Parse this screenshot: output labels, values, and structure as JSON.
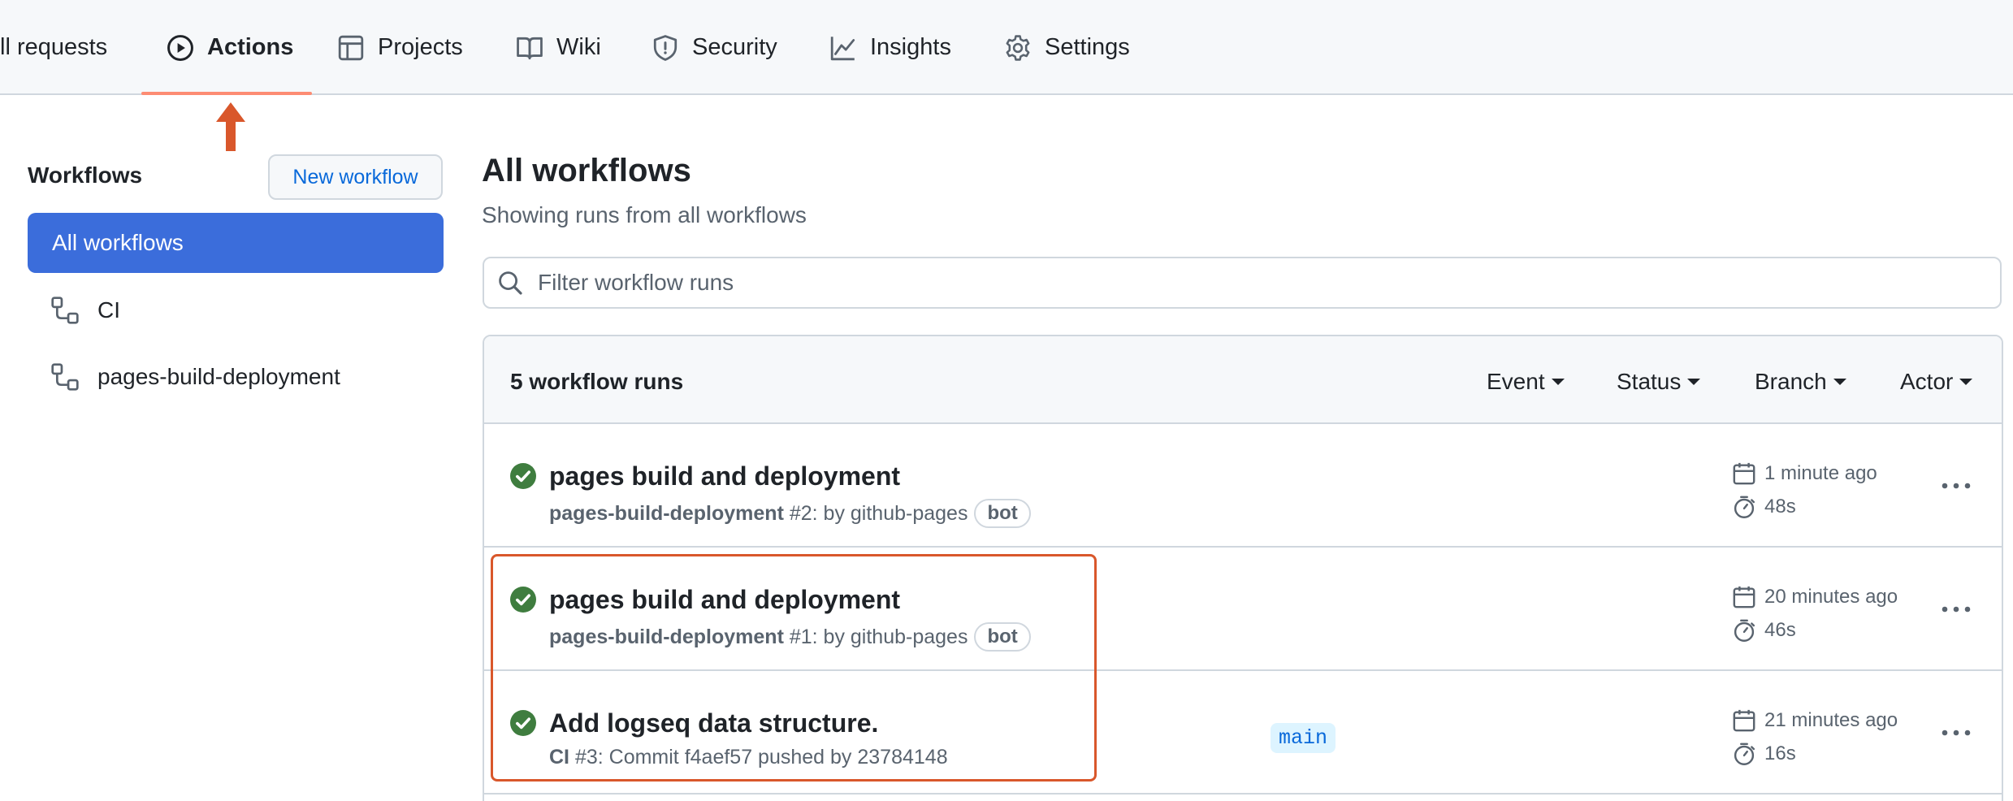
{
  "nav": {
    "tabs": [
      {
        "label": "ll requests",
        "icon": "pull-request-icon"
      },
      {
        "label": "Actions",
        "icon": "play-icon",
        "active": true
      },
      {
        "label": "Projects",
        "icon": "table-icon"
      },
      {
        "label": "Wiki",
        "icon": "book-icon"
      },
      {
        "label": "Security",
        "icon": "shield-icon"
      },
      {
        "label": "Insights",
        "icon": "graph-icon"
      },
      {
        "label": "Settings",
        "icon": "gear-icon"
      }
    ]
  },
  "sidebar": {
    "title": "Workflows",
    "new_workflow_label": "New workflow",
    "items": [
      {
        "label": "All workflows",
        "selected": true
      },
      {
        "label": "CI",
        "icon": "workflow-icon"
      },
      {
        "label": "pages-build-deployment",
        "icon": "workflow-icon"
      }
    ]
  },
  "main": {
    "title": "All workflows",
    "subtitle": "Showing runs from all workflows",
    "search": {
      "placeholder": "Filter workflow runs",
      "value": ""
    },
    "runs_box": {
      "count_label": "5 workflow runs",
      "filters": [
        "Event",
        "Status",
        "Branch",
        "Actor"
      ],
      "runs": [
        {
          "title": "pages build and deployment",
          "workflow": "pages-build-deployment",
          "detail": " #2: by github-pages",
          "badge": "bot",
          "branch": "",
          "time_ago": "1 minute ago",
          "duration": "48s",
          "status": "success"
        },
        {
          "title": "pages build and deployment",
          "workflow": "pages-build-deployment",
          "detail": " #1: by github-pages",
          "badge": "bot",
          "branch": "",
          "time_ago": "20 minutes ago",
          "duration": "46s",
          "status": "success"
        },
        {
          "title": "Add logseq data structure.",
          "workflow": "CI",
          "detail": " #3: Commit f4aef57 pushed by 23784148",
          "badge": "",
          "branch": "main",
          "time_ago": "21 minutes ago",
          "duration": "16s",
          "status": "success"
        }
      ]
    }
  },
  "colors": {
    "accent": "#3b6ddb",
    "success": "#3f7d3f",
    "annotation": "#d9572b",
    "tab_underline": "#fd8c73"
  }
}
